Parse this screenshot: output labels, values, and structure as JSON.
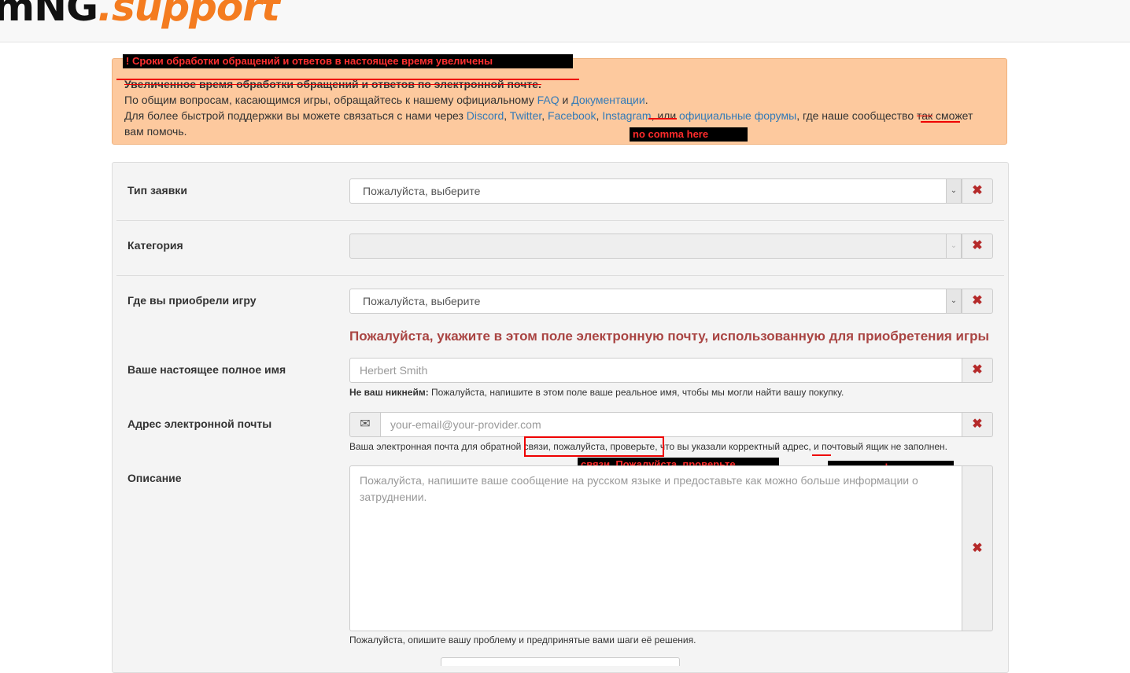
{
  "header": {
    "logo_part1": "mNG",
    "logo_part2": ".support"
  },
  "alert": {
    "highlight_label": "! Сроки обработки обращений и ответов в настоящее время увеличены",
    "struck_line": "Увеличенное время обработки обращений и ответов по электронной почте.",
    "line2_prefix": "По общим вопросам, касающимся игры, обращайтесь к нашему официальному ",
    "faq_link": "FAQ",
    "and_word": " и ",
    "docs_link": "Документации",
    "period": ".",
    "line3_prefix": "Для более быстрой поддержки вы можете связаться с нами через ",
    "discord_link": "Discord",
    "comma1": ", ",
    "twitter_link": "Twitter",
    "comma2": ", ",
    "facebook_link": "Facebook",
    "comma3": ", ",
    "instagram_link": "Instagram",
    "comma4": ", или ",
    "forums_link": "официальные форумы",
    "line3_mid": ", где наше сообщество ",
    "struck_word": "так",
    "line3_end": " сможет",
    "line4": "вам помочь.",
    "annotation1": "no comma here"
  },
  "form": {
    "ticket_type": {
      "label": "Тип заявки",
      "value": "Пожалуйста, выберите"
    },
    "category": {
      "label": "Категория",
      "value": ""
    },
    "purchase": {
      "label": "Где вы приобрели игру",
      "value": "Пожалуйста, выберите"
    },
    "warning": "Пожалуйста, укажите в этом поле электронную почту, использованную для приобретения игры",
    "full_name": {
      "label": "Ваше настоящее полное имя",
      "placeholder": "Herbert Smith",
      "help_bold": "Не ваш никнейм:",
      "help_text": " Пожалуйста, напишите в этом поле ваше реальное имя, чтобы мы могли найти вашу покупку."
    },
    "email": {
      "label": "Адрес электронной почты",
      "placeholder": "your-email@your-provider.com",
      "help_a": "Ваша электронная почта для обратной ",
      "help_boxed": "связи, пожалуйста, проверьте",
      "help_b": ", что вы указали корректный адрес",
      "help_c": ", и почтовый ящик не заполнен.",
      "annotation_fix": "связи. Пожалуйста, проверьте",
      "annotation_comma": "no comma here"
    },
    "description": {
      "label": "Описание",
      "placeholder": "Пожалуйста, напишите ваше сообщение на русском языке и предоставьте как можно больше информации о затруднении.",
      "help": "Пожалуйста, опишите вашу проблему и предпринятые вами шаги её решения."
    },
    "clear_icon": "✖",
    "caret_icon": "⌄",
    "envelope_icon": "✉"
  }
}
